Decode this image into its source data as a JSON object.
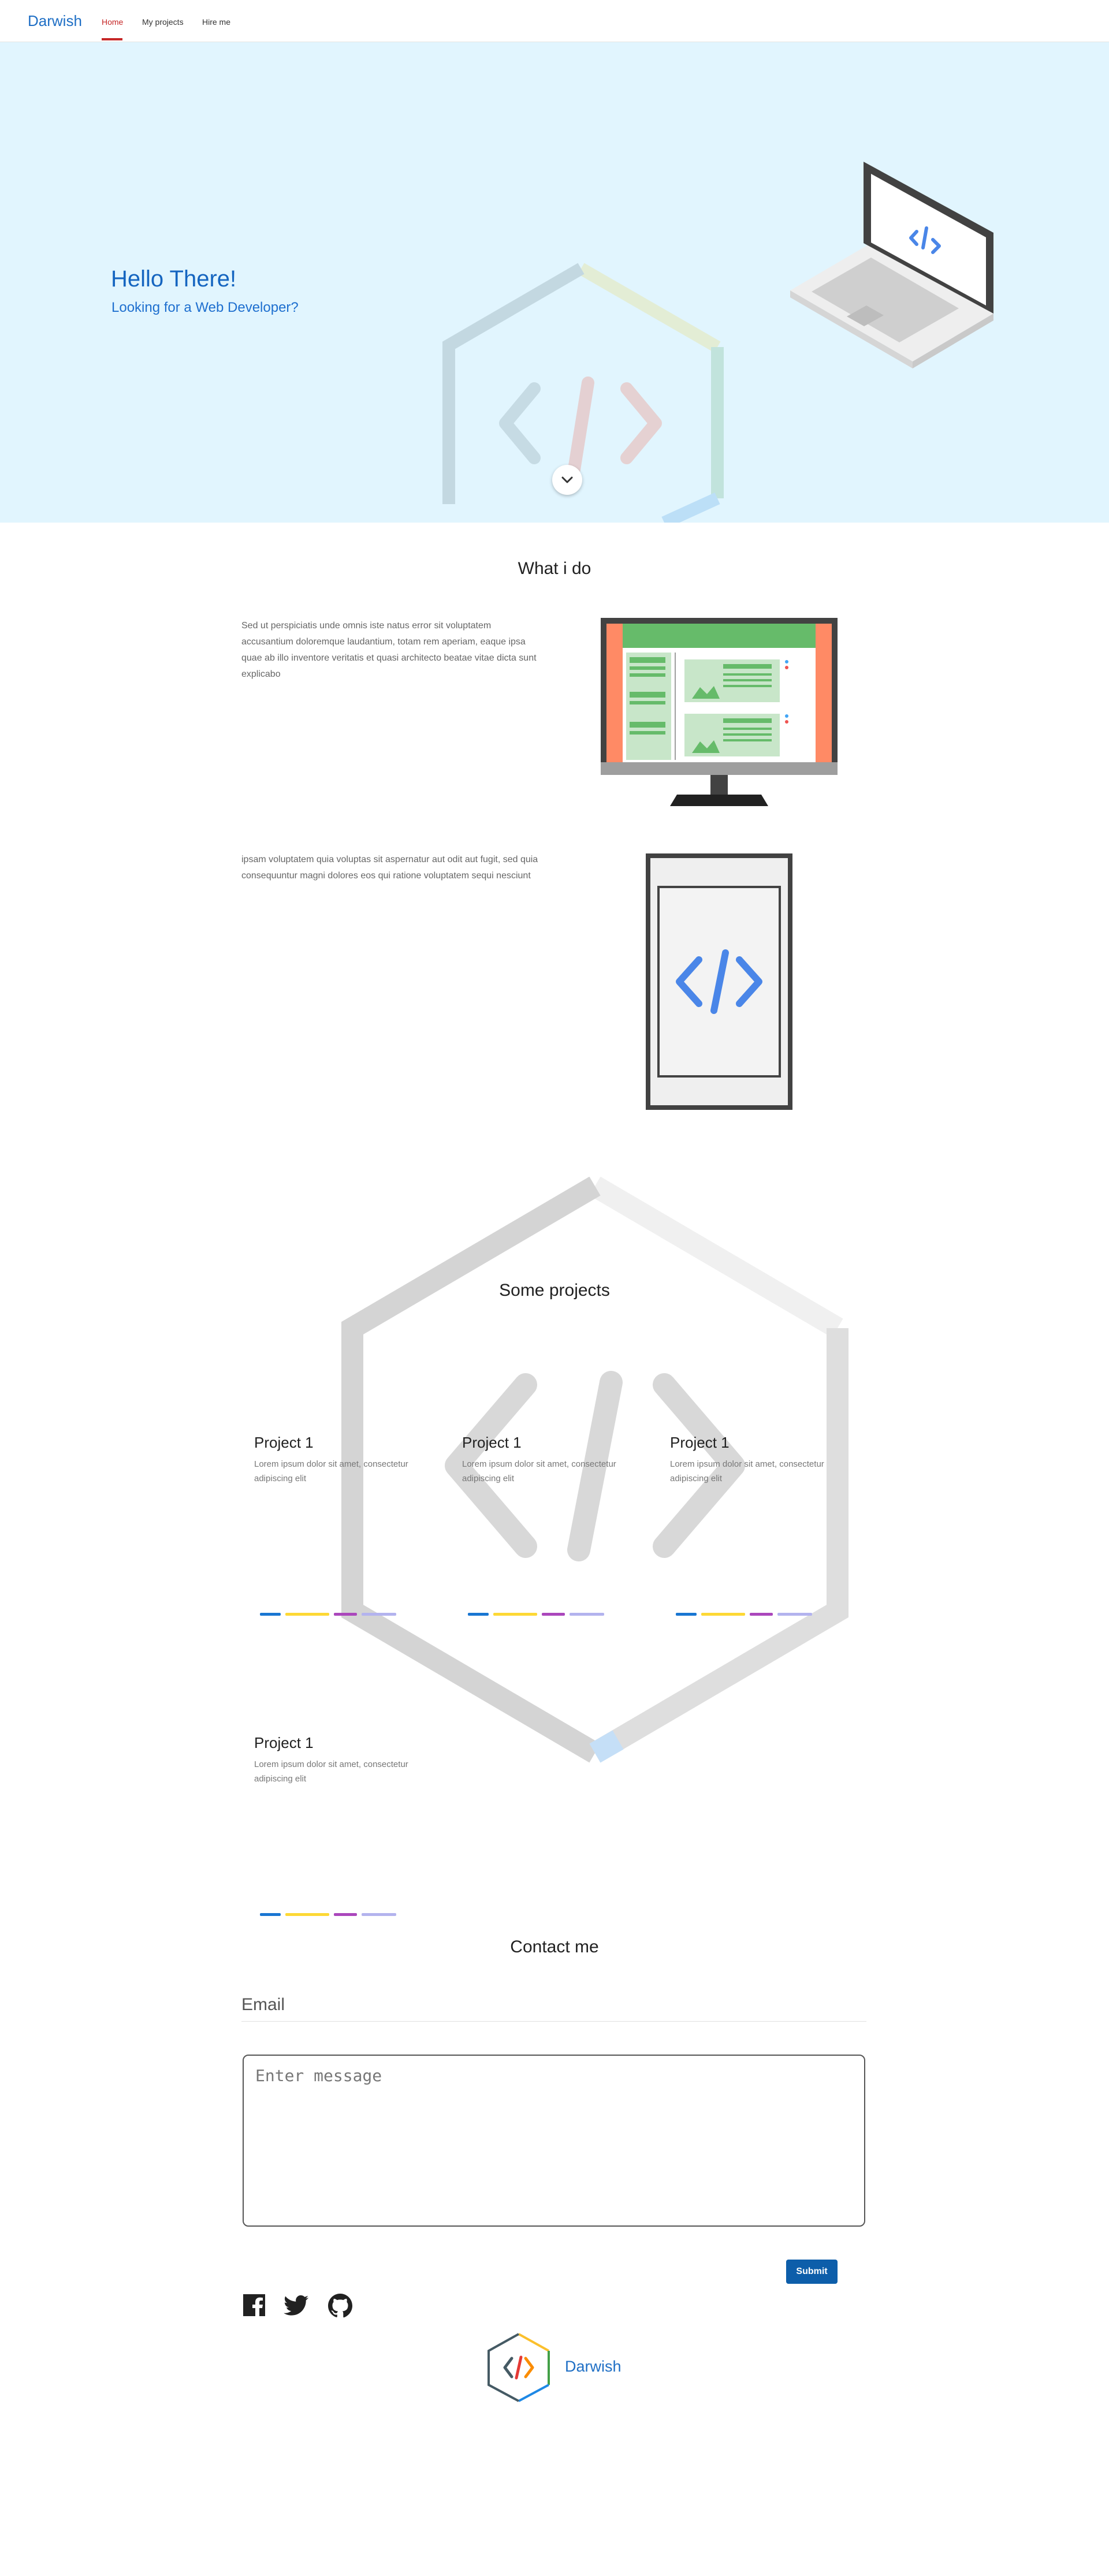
{
  "navbar": {
    "brand": "Darwish",
    "links": [
      {
        "label": "Home",
        "active": true
      },
      {
        "label": "My projects",
        "active": false
      },
      {
        "label": "Hire me",
        "active": false
      }
    ]
  },
  "hero": {
    "title": "Hello There!",
    "subtitle": "Looking for a Web Developer?",
    "background": "#e1f5fe",
    "accent": "#1565c0",
    "scroll_icon": "chevron-down-icon"
  },
  "services": {
    "heading": "What i do",
    "items": [
      {
        "text": "Sed ut perspiciatis unde omnis iste natus error sit voluptatem accusantium doloremque laudantium, totam rem aperiam, eaque ipsa quae ab illo inventore veritatis et quasi architecto beatae vitae dicta sunt explicabo",
        "image": "desktop-monitor-illustration"
      },
      {
        "text": "ipsam voluptatem quia voluptas sit aspernatur aut odit aut fugit, sed quia consequuntur magni dolores eos qui ratione voluptatem sequi nesciunt",
        "image": "mobile-phone-illustration"
      }
    ]
  },
  "projects": {
    "heading": "Some projects",
    "items": [
      {
        "title": "Project 1",
        "description": "Lorem ipsum dolor sit amet, consectetur adipiscing elit"
      },
      {
        "title": "Project 1",
        "description": "Lorem ipsum dolor sit amet, consectetur adipiscing elit"
      },
      {
        "title": "Project 1",
        "description": "Lorem ipsum dolor sit amet, consectetur adipiscing elit"
      },
      {
        "title": "Project 1",
        "description": "Lorem ipsum dolor sit amet, consectetur adipiscing elit"
      }
    ],
    "tag_colors": [
      "#1976d2",
      "#fdd835",
      "#ab47bc",
      "#b3b3ee"
    ]
  },
  "contact": {
    "heading": "Contact me",
    "email_label": "Email",
    "message_placeholder": "Enter message",
    "submit_label": "Submit"
  },
  "social": [
    "facebook-icon",
    "twitter-icon",
    "github-icon"
  ],
  "footer": {
    "brand": "Darwish"
  },
  "colors": {
    "brand_blue": "#1f6fc5",
    "active_nav": "#c62828",
    "submit": "#0d5eaa"
  }
}
